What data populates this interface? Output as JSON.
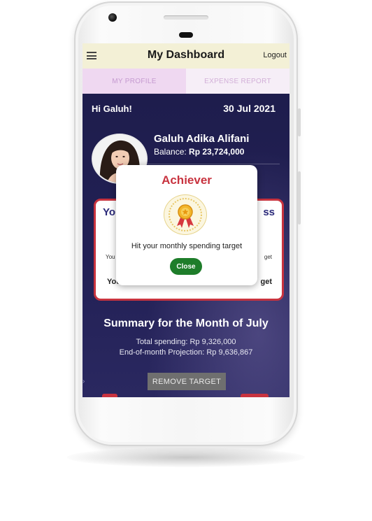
{
  "app": {
    "title": "My Dashboard",
    "logout_label": "Logout",
    "menu_icon": "hamburger-menu-icon"
  },
  "tabs": [
    {
      "label": "MY PROFILE",
      "active": true
    },
    {
      "label": "EXPENSE REPORT",
      "active": false
    }
  ],
  "profile": {
    "greeting": "Hi Galuh!",
    "date": "30 Jul 2021",
    "name": "Galuh Adika Alifani",
    "balance_label": "Balance: ",
    "balance_value": "Rp 23,724,000"
  },
  "card": {
    "title_left": "Yo",
    "title_right": "ss",
    "small_left": "You",
    "small_right": "get",
    "bottom_left": "You",
    "bottom_right": "get",
    "border_color": "#c8333f"
  },
  "summary": {
    "title": "Summary for the Month of July",
    "total_spending": "Total spending: Rp 9,326,000",
    "projection": "End-of-month Projection: Rp 9,636,867",
    "remove_label": "REMOVE TARGET"
  },
  "dialog": {
    "title": "Achiever",
    "icon": "achievement-medal-icon",
    "message": "Hit your monthly spending target",
    "close_label": "Close"
  },
  "colors": {
    "accent_red": "#c8333f",
    "screen_bg": "#1d1c4a",
    "close_green": "#1e7d2a",
    "appbar_bg": "#f3f0d6"
  }
}
